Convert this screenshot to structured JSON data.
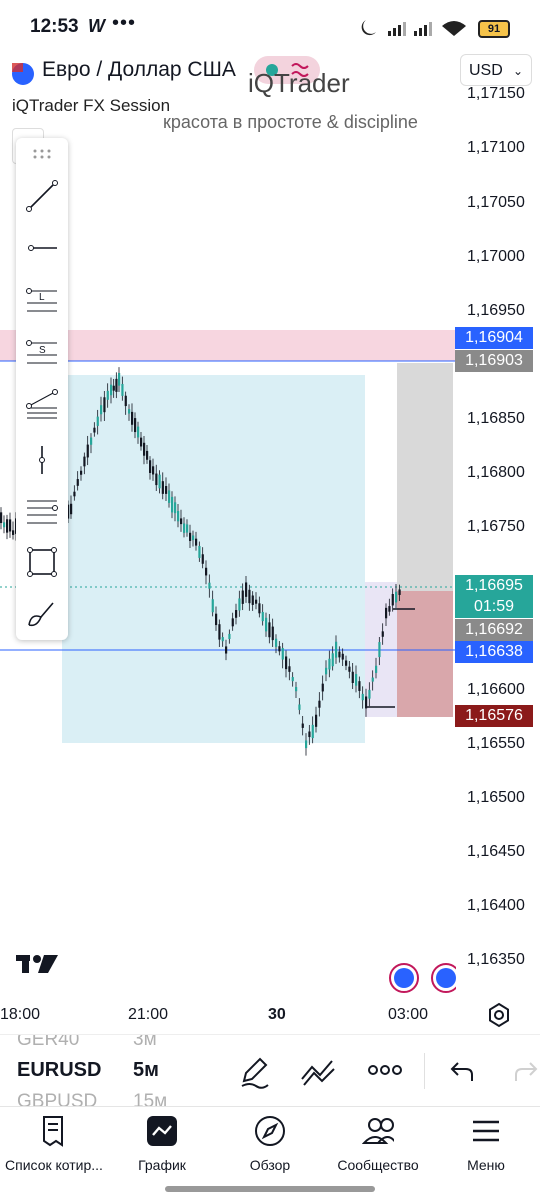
{
  "status_bar": {
    "time": "12:53",
    "app_badge": "W",
    "more": "•••",
    "battery": "91"
  },
  "header": {
    "symbol": "Евро / Доллар США",
    "session": "iQTrader FX Session",
    "brand": "iQTrader",
    "slogan": "красота в простоте & discipline",
    "currency": "USD"
  },
  "price_axis": {
    "ticks": [
      "1,17150",
      "1,17100",
      "1,17050",
      "1,17000",
      "1,16950",
      "1,16850",
      "1,16800",
      "1,16750",
      "1,16600",
      "1,16550",
      "1,16500",
      "1,16450",
      "1,16400",
      "1,16350"
    ],
    "tags": [
      {
        "text": "1,16904",
        "color": "#2962ff"
      },
      {
        "text": "1,16903",
        "color": "#8a8a8a"
      },
      {
        "text": "1,16695",
        "color": "#26a69a"
      },
      {
        "text": "01:59",
        "color": "#26a69a"
      },
      {
        "text": "1,16692",
        "color": "#8a8a8a"
      },
      {
        "text": "1,16638",
        "color": "#2962ff"
      },
      {
        "text": "1,16576",
        "color": "#8b1a1a"
      }
    ]
  },
  "time_axis": [
    "18:00",
    "21:00",
    "30",
    "03:00"
  ],
  "tickers": {
    "prev": {
      "symbol": "GER40",
      "interval": "3м"
    },
    "current": {
      "symbol": "EURUSD",
      "interval": "5м"
    },
    "next": {
      "symbol": "GBPUSD",
      "interval": "15м"
    }
  },
  "nav": [
    {
      "label": "Список котир...",
      "icon": "watchlist-icon"
    },
    {
      "label": "График",
      "icon": "chart-icon"
    },
    {
      "label": "Обзор",
      "icon": "compass-icon"
    },
    {
      "label": "Сообщество",
      "icon": "community-icon"
    },
    {
      "label": "Меню",
      "icon": "menu-icon"
    }
  ],
  "colors": {
    "up": "#26a69a",
    "down": "#131722",
    "accent_blue": "#2962ff",
    "zone_pink": "#f7d6e0",
    "zone_blue": "#d4ecf3",
    "zone_grey": "#d9d9d9",
    "zone_red": "#d9a7ab"
  },
  "logo": "TV"
}
